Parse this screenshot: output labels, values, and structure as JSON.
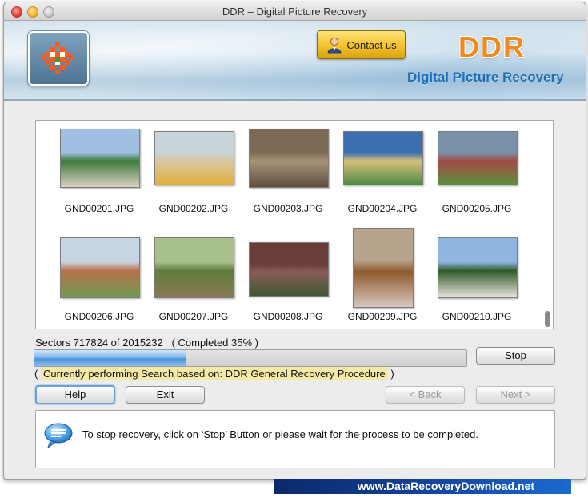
{
  "window": {
    "title": "DDR – Digital Picture Recovery"
  },
  "header": {
    "contact_label": "Contact us",
    "logo_text": "DDR",
    "subtitle": "Digital Picture Recovery"
  },
  "files": [
    {
      "name": "GND00201.JPG",
      "colors": [
        "#9fc0e0",
        "#3f7a3a",
        "#d9d2c4"
      ]
    },
    {
      "name": "GND00202.JPG",
      "colors": [
        "#c9d3da",
        "#d8c8a0",
        "#e0b040"
      ]
    },
    {
      "name": "GND00203.JPG",
      "colors": [
        "#7d6a55",
        "#a69378",
        "#5e4f40"
      ]
    },
    {
      "name": "GND00204.JPG",
      "colors": [
        "#3c6fb0",
        "#d9c07a",
        "#4f8a45"
      ]
    },
    {
      "name": "GND00205.JPG",
      "colors": [
        "#7a8fa8",
        "#a24a44",
        "#5d8f3f"
      ]
    },
    {
      "name": "GND00206.JPG",
      "colors": [
        "#c7d4e2",
        "#b8714a",
        "#6e9a52"
      ]
    },
    {
      "name": "GND00207.JPG",
      "colors": [
        "#a8c08a",
        "#5f7d3c",
        "#8a7b55"
      ]
    },
    {
      "name": "GND00208.JPG",
      "colors": [
        "#6a3d3a",
        "#8a5a58",
        "#3d5a32"
      ]
    },
    {
      "name": "GND00209.JPG",
      "colors": [
        "#b6a58c",
        "#8f5a2c",
        "#d8c8c0"
      ]
    },
    {
      "name": "GND00210.JPG",
      "colors": [
        "#8fb6e0",
        "#2f5a2a",
        "#e8e4dc"
      ]
    }
  ],
  "progress": {
    "sectors_text": "Sectors 717824 of 2015232",
    "completed_text": "( Completed 35% )",
    "percent": 35,
    "stop_label": "Stop"
  },
  "status": {
    "open_paren": "(",
    "text": "Currently performing Search based on: DDR General Recovery Procedure",
    "close_paren": ")"
  },
  "buttons": {
    "help": "Help",
    "exit": "Exit",
    "back": "< Back",
    "next": "Next >"
  },
  "info": {
    "message": "To stop recovery, click on ‘Stop’ Button or please wait for the process to be completed."
  },
  "footer": {
    "url": "www.DataRecoveryDownload.net"
  },
  "colors": {
    "accent": "#1f6fb5",
    "logo": "#f08a1c",
    "progress": "#4a92d8",
    "highlight": "#f6e9a6"
  }
}
